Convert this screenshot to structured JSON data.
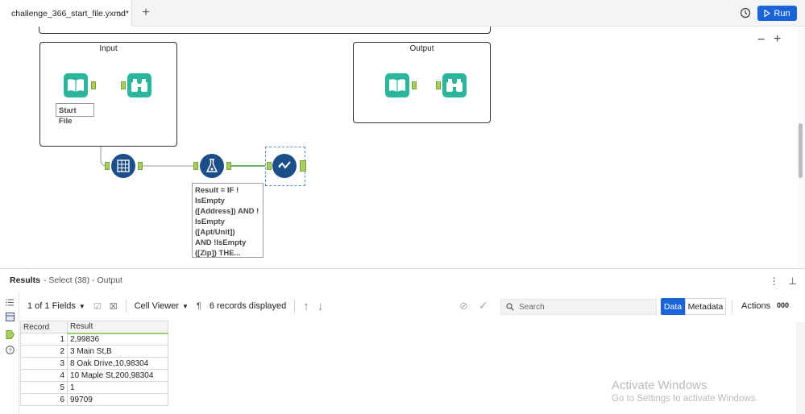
{
  "tab": {
    "title": "challenge_366_start_file.yxmd*",
    "close": "×",
    "add": "+"
  },
  "run_label": "Run",
  "canvas": {
    "zoom_minus": "−",
    "zoom_plus": "+",
    "input_box_title": "Input",
    "output_box_title": "Output",
    "start_file_label": "Start File",
    "annotation_lines": [
      "Result = IF !",
      "IsEmpty",
      "([Address]) AND !",
      "IsEmpty",
      "([Apt/Unit])",
      "AND !IsEmpty",
      "([Zip]) THE..."
    ]
  },
  "results": {
    "title": "Results",
    "subtitle": "- Select (38) - Output",
    "fields_label": "1 of 1 Fields",
    "cell_viewer_label": "Cell Viewer",
    "records_label": "6 records displayed",
    "search_placeholder": "Search",
    "data_tab": "Data",
    "metadata_tab": "Metadata",
    "actions_label": "Actions",
    "actions_more": "000",
    "columns": [
      "Record",
      "Result"
    ],
    "rows": [
      {
        "record": "1",
        "result": "2,99836"
      },
      {
        "record": "2",
        "result": "3 Main St,B"
      },
      {
        "record": "3",
        "result": "8 Oak Drive,10,98304"
      },
      {
        "record": "4",
        "result": "10 Maple St,200,98304"
      },
      {
        "record": "5",
        "result": "1"
      },
      {
        "record": "6",
        "result": "99709"
      }
    ]
  },
  "watermark": {
    "line1": "Activate Windows",
    "line2": "Go to Settings to activate Windows."
  },
  "colors": {
    "accent": "#1a64d8",
    "tool_teal": "#2bb59a",
    "tool_navy": "#1c4e8a",
    "anchor_green": "#a7cf5b"
  }
}
